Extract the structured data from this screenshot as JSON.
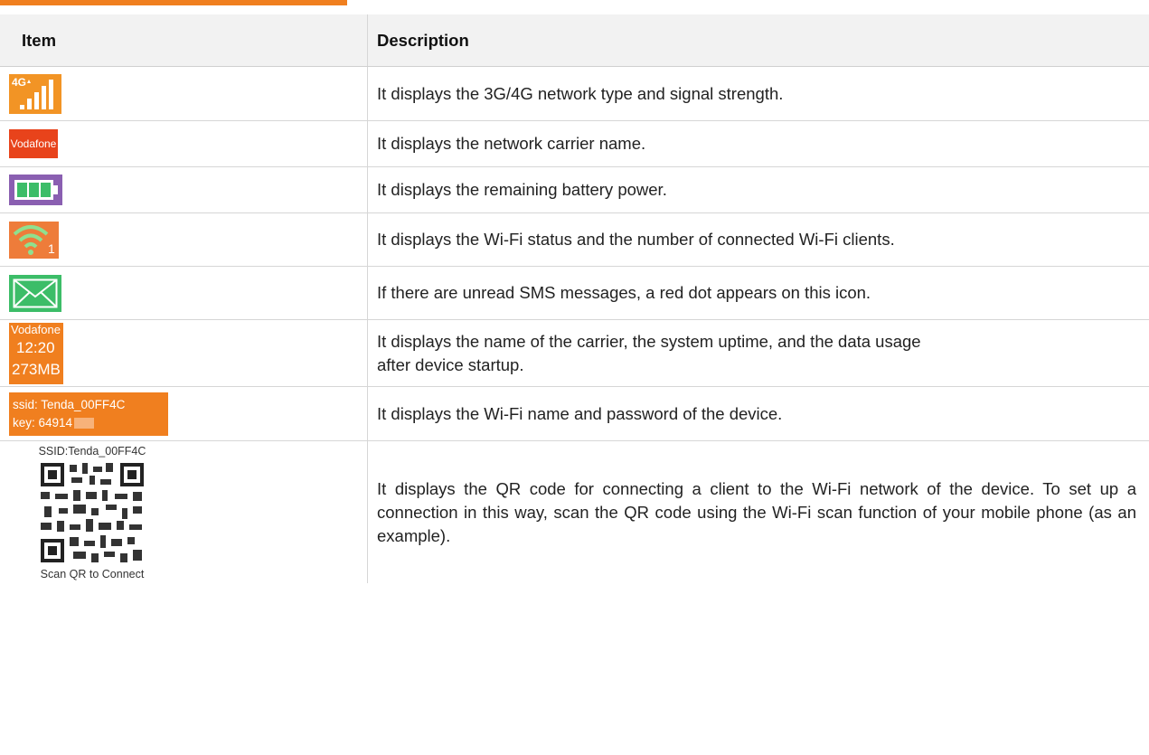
{
  "header": {
    "col_item": "Item",
    "col_description": "Description"
  },
  "rows": {
    "signal": {
      "icon_label": "4G",
      "description": "It displays the 3G/4G network type and signal strength."
    },
    "carrier": {
      "icon_label": "Vodafone",
      "description": "It displays the network carrier name."
    },
    "battery": {
      "description": "It displays the remaining battery power."
    },
    "wifi": {
      "icon_label": "1",
      "description": "It displays the Wi-Fi status and the number of connected Wi-Fi clients."
    },
    "sms": {
      "description": "If there are unread SMS messages, a red dot appears on this icon."
    },
    "usage": {
      "icon_carrier": "Vodafone",
      "icon_time": "12:20",
      "icon_data": "273MB",
      "description_line1": "It displays the name of the carrier, the system uptime, and the data usage",
      "description_line2": "after device startup."
    },
    "ssid": {
      "icon_ssid": "ssid: Tenda_00FF4C",
      "icon_key": "key: 64914",
      "description": "It displays the Wi-Fi name and password of the device."
    },
    "qr": {
      "icon_top": "SSID:Tenda_00FF4C",
      "icon_bottom": "Scan QR to Connect",
      "description": "It displays the QR code for connecting a client to the Wi-Fi network of the device. To set up a connection in this way, scan the QR code using the Wi-Fi scan function of your mobile phone (as an example)."
    }
  },
  "colors": {
    "accent": "#f07f1f",
    "carrier": "#e8431b",
    "battery": "#8a5fb1",
    "mail": "#3cbd68",
    "wifi": "#ee7c3a"
  }
}
